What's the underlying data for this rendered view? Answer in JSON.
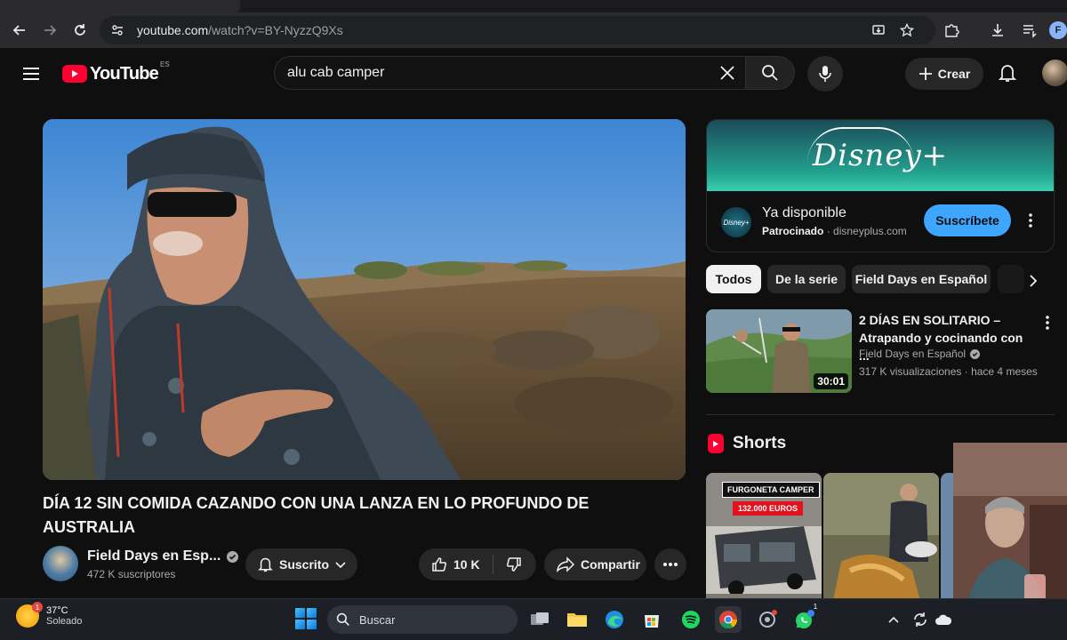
{
  "browser": {
    "url_host": "youtube.com",
    "url_path": "/watch?v=BY-NyzzQ9Xs",
    "profile_initial": "F"
  },
  "header": {
    "logo_text": "YouTube",
    "logo_country": "ES",
    "search_value": "alu cab camper",
    "create_label": "Crear"
  },
  "video": {
    "title": "DÍA 12 SIN COMIDA CAZANDO CON UNA LANZA EN LO PROFUNDO DE AUSTRALIA",
    "channel_name": "Field Days en Esp...",
    "subscribers": "472 K suscriptores",
    "subscribed_label": "Suscrito",
    "likes": "10 K",
    "share_label": "Compartir"
  },
  "ad": {
    "brand": "Disney+",
    "logo_text": "Disney+",
    "title": "Ya disponible",
    "sponsored": "Patrocinado",
    "domain": "disneyplus.com",
    "cta": "Suscríbete"
  },
  "chips": [
    {
      "label": "Todos",
      "active": true
    },
    {
      "label": "De la serie",
      "active": false
    },
    {
      "label": "Field Days en Español",
      "active": false
    }
  ],
  "recommended": {
    "title": "2 DÍAS EN SOLITARIO – Atrapando y cocinando con ...",
    "channel": "Field Days en Español",
    "views": "317 K visualizaciones",
    "age": "hace 4 meses",
    "duration": "30:01"
  },
  "shorts": {
    "heading": "Shorts",
    "short1_line1": "FURGONETA CAMPER",
    "short1_line2": "132.000 EUROS"
  },
  "taskbar": {
    "temperature": "37°C",
    "condition": "Soleado",
    "weather_badge": "1",
    "search_label": "Buscar",
    "whatsapp_badge": "1"
  },
  "colors": {
    "youtube_red": "#ff0033",
    "subscribe_blue": "#3ea6ff",
    "background": "#0f0f0f"
  }
}
